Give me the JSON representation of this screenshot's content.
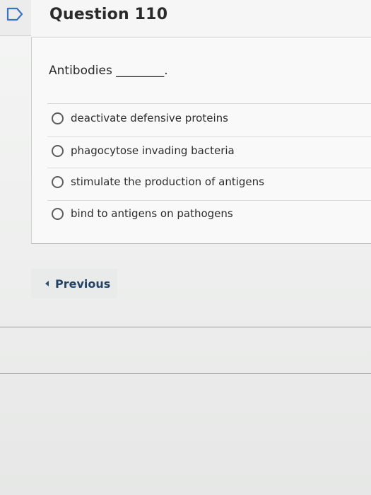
{
  "question": {
    "title": "Question 110",
    "prompt": "Antibodies ________.",
    "options": [
      "deactivate defensive proteins",
      "phagocytose invading bacteria",
      "stimulate the production of antigens",
      "bind to antigens on pathogens"
    ]
  },
  "navigation": {
    "previous_label": "Previous"
  },
  "icons": {
    "flag": "flag-icon",
    "previous": "caret-left-icon",
    "radio": "radio-unselected-icon"
  },
  "colors": {
    "flag_outline": "#3b73c4",
    "link_text": "#234466"
  }
}
